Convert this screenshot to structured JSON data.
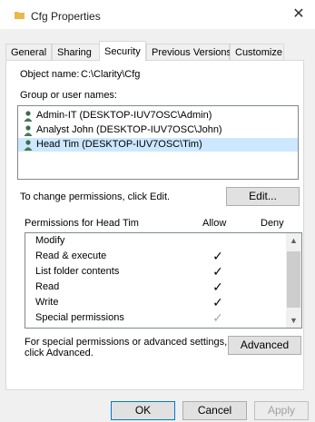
{
  "window": {
    "title": "Cfg Properties",
    "close_glyph": "✕"
  },
  "tabs": [
    {
      "label": "General"
    },
    {
      "label": "Sharing"
    },
    {
      "label": "Security"
    },
    {
      "label": "Previous Versions"
    },
    {
      "label": "Customize"
    }
  ],
  "object": {
    "label": "Object name:",
    "value": "C:\\Clarity\\Cfg"
  },
  "groups": {
    "label": "Group or user names:",
    "items": [
      {
        "label": "Admin-IT (DESKTOP-IUV7OSC\\Admin)"
      },
      {
        "label": "Analyst John (DESKTOP-IUV7OSC\\John)"
      },
      {
        "label": "Head Tim (DESKTOP-IUV7OSC\\Tim)"
      }
    ]
  },
  "change_text": "To change permissions, click Edit.",
  "edit_label": "Edit...",
  "permissions": {
    "label": "Permissions for Head Tim",
    "allow_header": "Allow",
    "deny_header": "Deny",
    "rows": [
      {
        "name": "Modify",
        "allow": ""
      },
      {
        "name": "Read & execute",
        "allow": "✓"
      },
      {
        "name": "List folder contents",
        "allow": "✓"
      },
      {
        "name": "Read",
        "allow": "✓"
      },
      {
        "name": "Write",
        "allow": "✓"
      },
      {
        "name": "Special permissions",
        "allow": "✓"
      }
    ]
  },
  "advanced_text_1": "For special permissions or advanced settings,",
  "advanced_text_2": "click Advanced.",
  "advanced_label": "Advanced",
  "footer": {
    "ok": "OK",
    "cancel": "Cancel",
    "apply": "Apply"
  },
  "colors": {
    "selection": "#cce8ff",
    "check_gray": "#a9a9a9",
    "folder": "#e8b84a"
  }
}
